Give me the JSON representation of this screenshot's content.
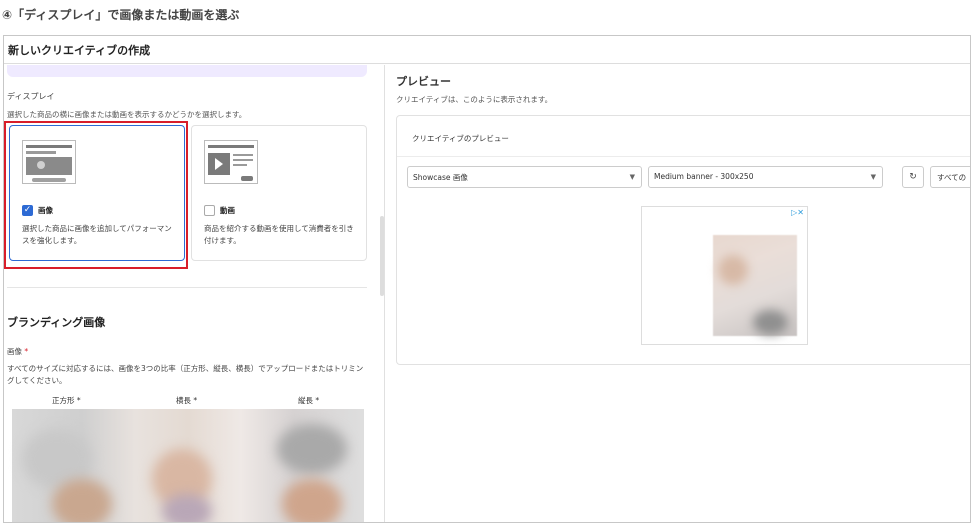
{
  "step_title": "④「ディスプレイ」で画像または動画を選ぶ",
  "window": {
    "title": "新しいクリエイティブの作成"
  },
  "display_section": {
    "label": "ディスプレイ",
    "description": "選択した商品の横に画像または動画を表示するかどうかを選択します。",
    "options": [
      {
        "title": "画像",
        "checked": true,
        "description": "選択した商品に画像を追加してパフォーマンスを強化します。"
      },
      {
        "title": "動画",
        "checked": false,
        "description": "商品を紹介する動画を使用して消費者を引き付けます。"
      }
    ]
  },
  "branding": {
    "title": "ブランディング画像",
    "image_label": "画像",
    "required_mark": "*",
    "description": "すべてのサイズに対応するには、画像を3つの比率（正方形、縦長、横長）でアップロードまたはトリミングしてください。",
    "columns": [
      "正方形 *",
      "横長 *",
      "縦長 *"
    ]
  },
  "preview": {
    "title": "プレビュー",
    "description": "クリエイティブは、このように表示されます。",
    "panel_title": "クリエイティブのプレビュー",
    "select_format": "Showcase 画像",
    "select_size": "Medium banner - 300x250",
    "refresh_icon": "refresh-icon",
    "all_button": "すべての"
  },
  "colors": {
    "accent": "#2d6ad4",
    "highlight": "#d81e2a",
    "banner": "#efeaff"
  }
}
